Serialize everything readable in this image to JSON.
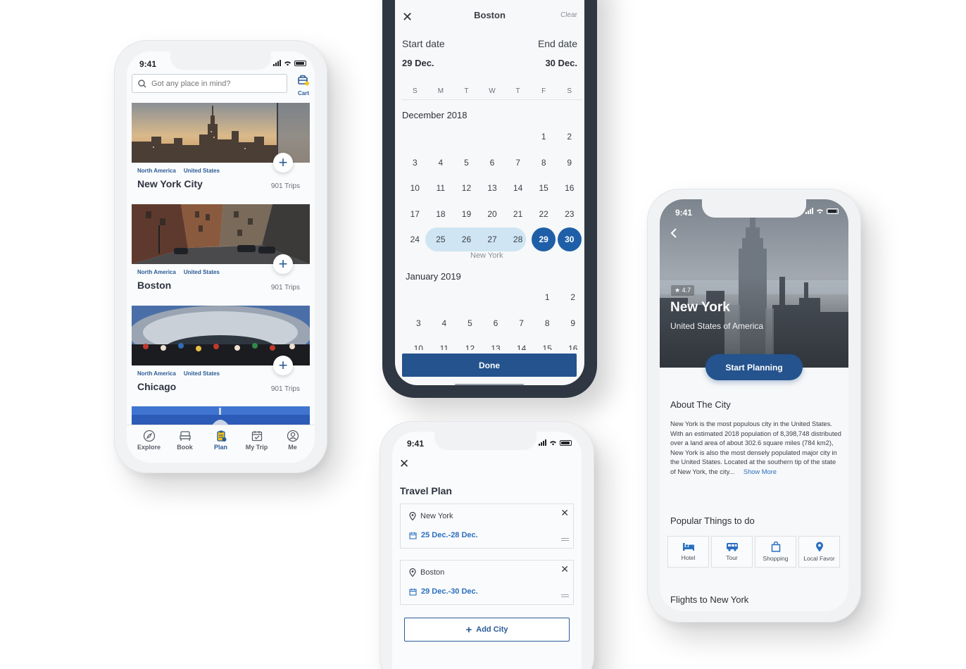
{
  "explore": {
    "status_time": "9:41",
    "search_placeholder": "Got any place in mind?",
    "cart_label": "Cart",
    "cities": [
      {
        "region": "North America",
        "country": "United States",
        "name": "New York City",
        "trips": "901 Trips"
      },
      {
        "region": "North America",
        "country": "United States",
        "name": "Boston",
        "trips": "901 Trips"
      },
      {
        "region": "North America",
        "country": "United States",
        "name": "Chicago",
        "trips": "901 Trips"
      }
    ],
    "tabs": [
      {
        "label": "Explore",
        "icon": "compass-icon"
      },
      {
        "label": "Book",
        "icon": "bed-icon"
      },
      {
        "label": "Plan",
        "icon": "plan-icon"
      },
      {
        "label": "My Trip",
        "icon": "calendar-icon"
      },
      {
        "label": "Me",
        "icon": "user-icon"
      }
    ],
    "active_tab": "Plan"
  },
  "calendar": {
    "title": "Boston",
    "clear_label": "Clear",
    "start_label": "Start date",
    "end_label": "End date",
    "start_value": "29 Dec.",
    "end_value": "30 Dec.",
    "weekdays": [
      "S",
      "M",
      "T",
      "W",
      "T",
      "F",
      "S"
    ],
    "month1": "December 2018",
    "month2": "January 2019",
    "range_note": "New York",
    "done_label": "Done"
  },
  "plan": {
    "status_time": "9:41",
    "title": "Travel Plan",
    "items": [
      {
        "city": "New York",
        "dates": "25 Dec.-28 Dec."
      },
      {
        "city": "Boston",
        "dates": "29 Dec.-30 Dec."
      }
    ],
    "add_label": "Add City"
  },
  "detail": {
    "status_time": "9:41",
    "rating": "4.7",
    "city": "New York",
    "country": "United States of America",
    "start_label": "Start Planning",
    "about_title": "About The City",
    "about_text": "New York is the most populous city in the United States. With an estimated 2018 population of 8,398,748 distributed over a land area of about 302.6 square miles (784 km2), New York is also the most densely populated major city in the United States. Located at the southern tip of the state of New York, the city...",
    "show_more": "Show More",
    "things_title": "Popular Things to do",
    "things": [
      {
        "label": "Hotel",
        "icon": "hotel-icon"
      },
      {
        "label": "Tour",
        "icon": "bus-icon"
      },
      {
        "label": "Shopping",
        "icon": "shopping-bag-icon"
      },
      {
        "label": "Local Favor",
        "icon": "location-pin-icon"
      }
    ],
    "flights_title": "Flights to New York"
  },
  "colors": {
    "brand": "#24538d",
    "link": "#2a6fc0",
    "range": "#cfe5f3",
    "selected": "#1e5fa8"
  }
}
